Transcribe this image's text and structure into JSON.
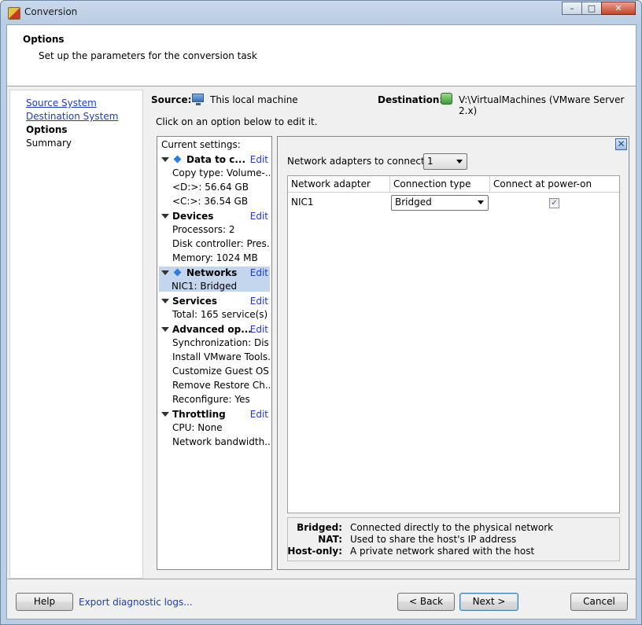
{
  "window": {
    "title": "Conversion",
    "controls": {
      "minimize": "–",
      "maximize": "□",
      "close": "✕"
    }
  },
  "header": {
    "title": "Options",
    "description": "Set up the parameters for the conversion task"
  },
  "steps": [
    {
      "label": "Source System",
      "state": "link"
    },
    {
      "label": "Destination System",
      "state": "link"
    },
    {
      "label": "Options",
      "state": "current"
    },
    {
      "label": "Summary",
      "state": "plain"
    }
  ],
  "source": {
    "label": "Source:",
    "value": "This local machine",
    "icon": "monitor-icon"
  },
  "destination": {
    "label": "Destination:",
    "value": "V:\\VirtualMachines (VMware Server 2.x)",
    "icon": "vm-icon"
  },
  "instruction": "Click on an option below to edit it.",
  "settings": {
    "header": "Current settings:",
    "edit_label": "Edit",
    "groups": [
      {
        "title": "Data to c...",
        "items": [
          "Copy type: Volume-...",
          "<D:>: 56.64 GB",
          "<C:>: 36.54 GB"
        ]
      },
      {
        "title": "Devices",
        "items": [
          "Processors: 2",
          "Disk controller: Pres...",
          "Memory: 1024 MB"
        ]
      },
      {
        "title": "Networks",
        "items": [
          "NIC1: Bridged"
        ]
      },
      {
        "title": "Services",
        "items": [
          "Total: 165 service(s)"
        ]
      },
      {
        "title": "Advanced op...",
        "items": [
          "Synchronization: Dis...",
          "Install VMware Tools...",
          "Customize Guest OS...",
          "Remove Restore Ch...",
          "Reconfigure: Yes"
        ]
      },
      {
        "title": "Throttling",
        "items": [
          "CPU: None",
          "Network bandwidth..."
        ]
      }
    ]
  },
  "network_panel": {
    "adapters_label": "Network adapters to connect",
    "adapters_value": "1",
    "columns": [
      "Network adapter",
      "Connection type",
      "Connect at power-on"
    ],
    "rows": [
      {
        "adapter": "NIC1",
        "connection_type": "Bridged",
        "connect_at_power_on": true
      }
    ],
    "legend": [
      {
        "key": "Bridged:",
        "value": "Connected directly to the physical network"
      },
      {
        "key": "NAT:",
        "value": "Used to share the host's IP address"
      },
      {
        "key": "Host-only:",
        "value": "A private network shared with the host"
      }
    ]
  },
  "footer": {
    "help": "Help",
    "export_logs": "Export diagnostic logs...",
    "back": "< Back",
    "next": "Next >",
    "cancel": "Cancel"
  }
}
